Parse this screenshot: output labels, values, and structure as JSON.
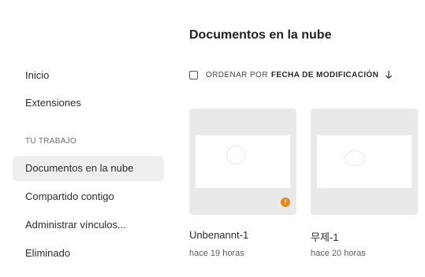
{
  "sidebar": {
    "items": [
      {
        "label": "Inicio",
        "active": false
      },
      {
        "label": "Extensiones",
        "active": false
      }
    ],
    "section_label": "TU TRABAJO",
    "work_items": [
      {
        "label": "Documentos en la nube",
        "active": true
      },
      {
        "label": "Compartido contigo",
        "active": false
      },
      {
        "label": "Administrar vínculos...",
        "active": false
      },
      {
        "label": "Eliminado",
        "active": false
      }
    ]
  },
  "main": {
    "title": "Documentos en la nube",
    "sort": {
      "prefix": "ORDENAR POR",
      "field": "FECHA DE MODIFICACIÓN",
      "direction_icon": "arrow-down-icon"
    },
    "documents": [
      {
        "name": "Unbenannt-1",
        "modified": "hace 19 horas",
        "warning": "!"
      },
      {
        "name": "무제-1",
        "modified": "hace 20 horas"
      }
    ]
  },
  "colors": {
    "active_bg": "#efefef",
    "thumb_bg": "#e9e9e9",
    "warning": "#e68619"
  }
}
